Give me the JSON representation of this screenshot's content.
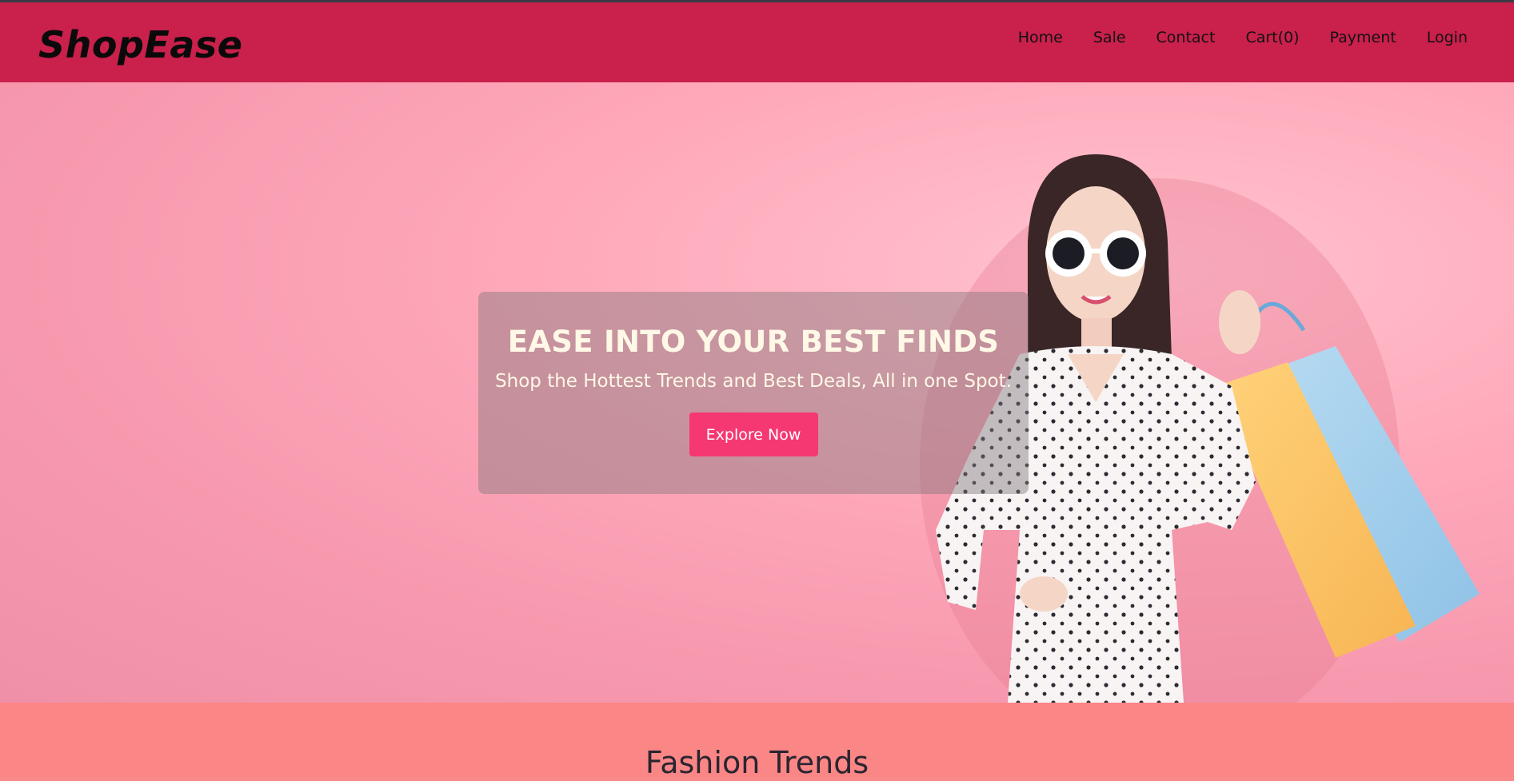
{
  "brand": {
    "name": "ShopEase"
  },
  "nav": {
    "items": [
      "Home",
      "Sale",
      "Contact",
      "Cart(0)",
      "Payment",
      "Login"
    ]
  },
  "hero": {
    "title": "EASE INTO YOUR BEST FINDS",
    "subtitle": "Shop the Hottest Trends and Best Deals, All in one Spot.",
    "cta_label": "Explore Now",
    "image": "woman-with-shopping-bags"
  },
  "section": {
    "title": "Fashion Trends"
  },
  "colors": {
    "header_bg": "#c9204c",
    "hero_bg": "#ffaabb",
    "cta_bg": "#f53772",
    "section_bg": "#fa8686"
  }
}
